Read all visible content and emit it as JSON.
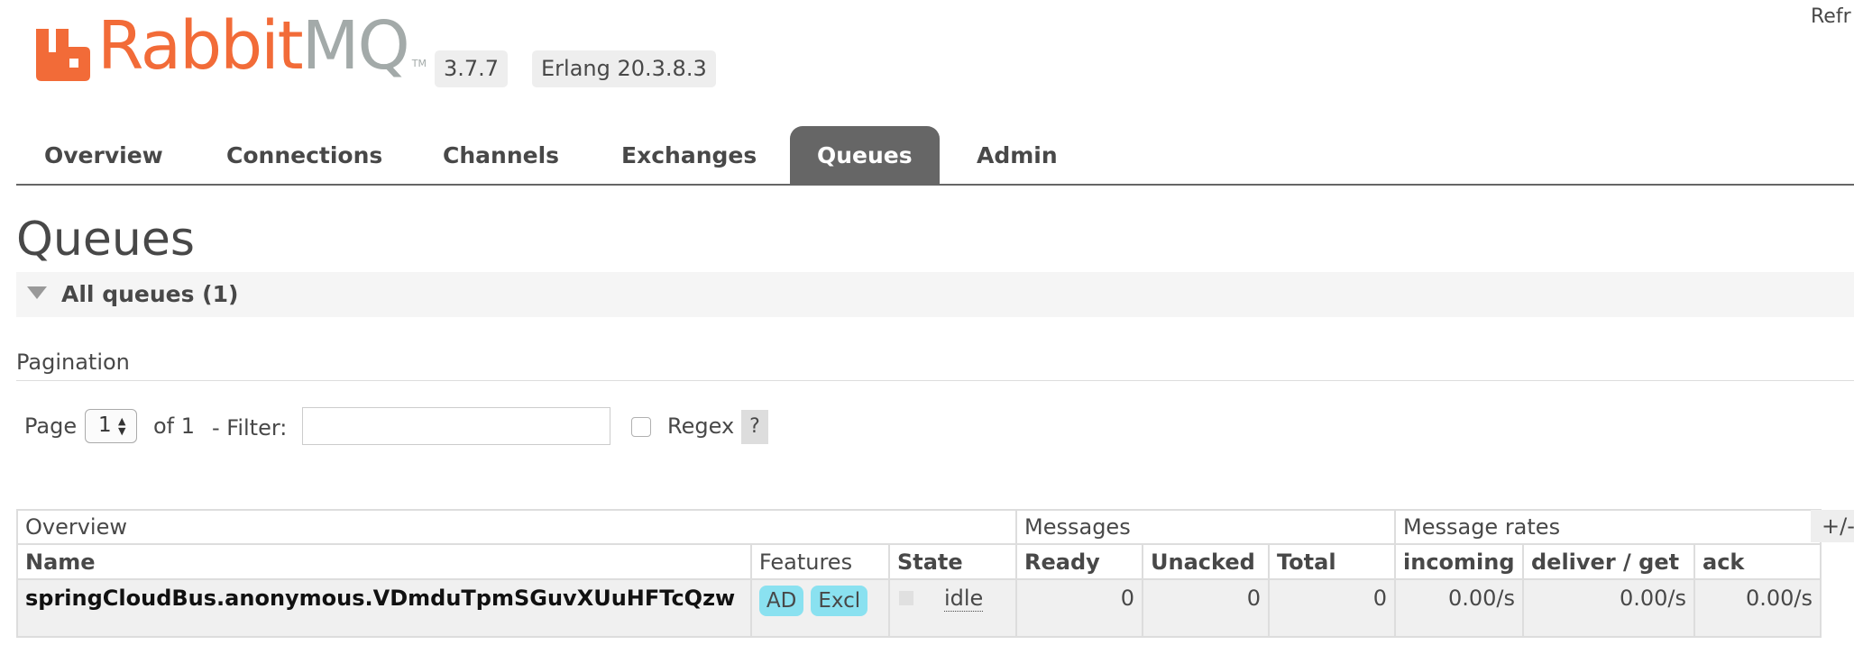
{
  "header": {
    "brand_rabbit": "Rabbit",
    "brand_mq": "MQ",
    "brand_tm": "TM",
    "version": "3.7.7",
    "erlang": "Erlang 20.3.8.3",
    "refresh_text": "Refr"
  },
  "tabs": [
    {
      "label": "Overview",
      "active": false
    },
    {
      "label": "Connections",
      "active": false
    },
    {
      "label": "Channels",
      "active": false
    },
    {
      "label": "Exchanges",
      "active": false
    },
    {
      "label": "Queues",
      "active": true
    },
    {
      "label": "Admin",
      "active": false
    }
  ],
  "page": {
    "title": "Queues",
    "section_title": "All queues (1)"
  },
  "pagination": {
    "title": "Pagination",
    "page_label": "Page",
    "page_value": "1",
    "of_label": "of 1",
    "filter_label": "- Filter:",
    "filter_value": "",
    "regex_label": "Regex",
    "regex_checked": false,
    "help_label": "?"
  },
  "table": {
    "groups": [
      "Overview",
      "Messages",
      "Message rates"
    ],
    "columns": [
      "Name",
      "Features",
      "State",
      "Ready",
      "Unacked",
      "Total",
      "incoming",
      "deliver / get",
      "ack"
    ],
    "rows": [
      {
        "name": "springCloudBus.anonymous.VDmduTpmSGuvXUuHFTcQzw",
        "features": [
          "AD",
          "Excl"
        ],
        "state": "idle",
        "ready": "0",
        "unacked": "0",
        "total": "0",
        "incoming": "0.00/s",
        "deliver_get": "0.00/s",
        "ack": "0.00/s"
      }
    ],
    "columns_toggle": "+/-"
  },
  "colors": {
    "brand_orange": "#f26b38",
    "brand_grey": "#a3aaa9",
    "tab_active_bg": "#666666",
    "feature_badge_bg": "#8ae1f0"
  }
}
